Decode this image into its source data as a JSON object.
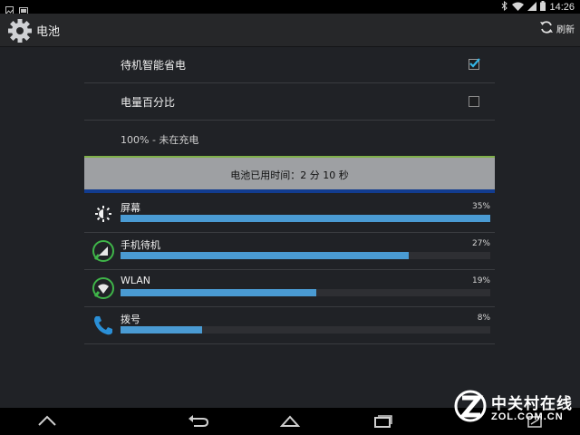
{
  "status_bar": {
    "time": "14:26",
    "icons": [
      "image-icon",
      "screenshot-icon",
      "bluetooth-icon",
      "wifi-icon",
      "signal-icon",
      "battery-icon"
    ]
  },
  "action_bar": {
    "title": "电池",
    "refresh_label": "刷新",
    "icons": [
      "settings-gear-icon",
      "refresh-icon"
    ]
  },
  "preferences": [
    {
      "label": "待机智能省电",
      "checked": true
    },
    {
      "label": "电量百分比",
      "checked": false
    }
  ],
  "battery_status": "100% - 未在充电",
  "time_on_battery": "电池已用时间：2 分 10 秒",
  "usage": [
    {
      "label": "屏幕",
      "percent_text": "35%",
      "bar_fraction": 1.0,
      "icon": "brightness-icon"
    },
    {
      "label": "手机待机",
      "percent_text": "27%",
      "bar_fraction": 0.78,
      "icon": "cell-standby-icon"
    },
    {
      "label": "WLAN",
      "percent_text": "19%",
      "bar_fraction": 0.53,
      "icon": "wlan-icon"
    },
    {
      "label": "拨号",
      "percent_text": "8%",
      "bar_fraction": 0.22,
      "icon": "phone-icon"
    }
  ],
  "nav_bar": {
    "icons": [
      "up-arrow-icon",
      "back-icon",
      "home-icon",
      "recents-icon",
      "screen-icon"
    ]
  },
  "watermark": {
    "brand_cn": "中关村在线",
    "brand_en": "ZOL.COM.CN"
  },
  "colors": {
    "accent_bar": "#4a9bd3",
    "checkbox_check": "#33b5e5",
    "panel_green_line": "#7fb049",
    "panel_blue_line": "#123c8f"
  }
}
